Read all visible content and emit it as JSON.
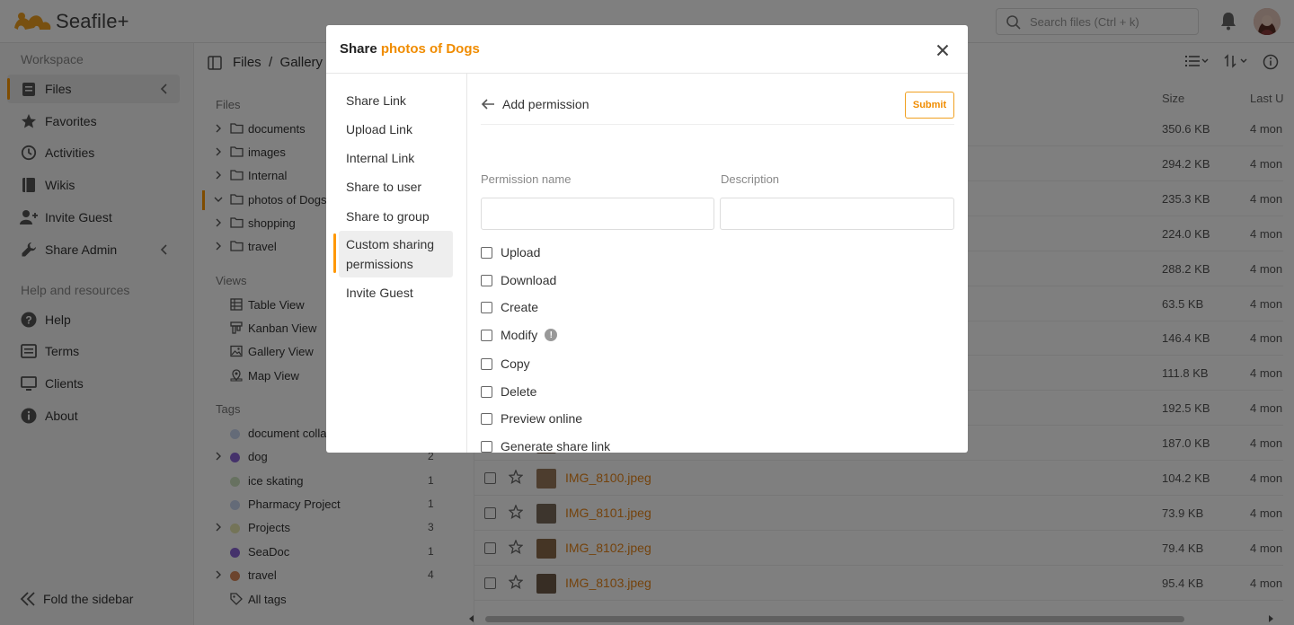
{
  "app": {
    "name": "Seafile+"
  },
  "header": {
    "search_placeholder": "Search files (Ctrl + k)"
  },
  "sidebar": {
    "workspace_title": "Workspace",
    "items": [
      {
        "label": "Files",
        "icon": "files-icon"
      },
      {
        "label": "Favorites",
        "icon": "star-icon"
      },
      {
        "label": "Activities",
        "icon": "clock-icon"
      },
      {
        "label": "Wikis",
        "icon": "book-icon"
      },
      {
        "label": "Invite Guest",
        "icon": "add-user-icon"
      },
      {
        "label": "Share Admin",
        "icon": "wrench-icon"
      }
    ],
    "help_title": "Help and resources",
    "help_items": [
      {
        "label": "Help",
        "icon": "help-icon"
      },
      {
        "label": "Terms",
        "icon": "list-icon"
      },
      {
        "label": "Clients",
        "icon": "monitor-icon"
      },
      {
        "label": "About",
        "icon": "info-icon"
      }
    ],
    "fold_label": "Fold the sidebar"
  },
  "tree": {
    "breadcrumb_root": "Files",
    "breadcrumb_sep": "/",
    "breadcrumb_current": "Gallery v",
    "files_title": "Files",
    "folders": [
      "documents",
      "images",
      "Internal",
      "photos of Dogs",
      "shopping",
      "travel"
    ],
    "views_title": "Views",
    "views": [
      "Table View",
      "Kanban View",
      "Gallery View",
      "Map View"
    ],
    "tags_title": "Tags",
    "tags": [
      {
        "label": "document colla",
        "count": "",
        "color": "#c9d6f0"
      },
      {
        "label": "dog",
        "count": "2",
        "color": "#8a64d6"
      },
      {
        "label": "ice skating",
        "count": "1",
        "color": "#cfe3c0"
      },
      {
        "label": "Pharmacy Project",
        "count": "1",
        "color": "#c9d6f0"
      },
      {
        "label": "Projects",
        "count": "3",
        "color": "#e8e8b0"
      },
      {
        "label": "SeaDoc",
        "count": "1",
        "color": "#8a64d6"
      },
      {
        "label": "travel",
        "count": "4",
        "color": "#d9895a"
      }
    ],
    "all_tags": "All tags"
  },
  "table": {
    "col_size": "Size",
    "col_modified": "Last U",
    "rows": [
      {
        "name": "",
        "size": "350.6 KB",
        "modified": "4 mon"
      },
      {
        "name": "",
        "size": "294.2 KB",
        "modified": "4 mon"
      },
      {
        "name": "",
        "size": "235.3 KB",
        "modified": "4 mon"
      },
      {
        "name": "",
        "size": "224.0 KB",
        "modified": "4 mon"
      },
      {
        "name": "",
        "size": "288.2 KB",
        "modified": "4 mon"
      },
      {
        "name": "",
        "size": "63.5 KB",
        "modified": "4 mon"
      },
      {
        "name": "",
        "size": "146.4 KB",
        "modified": "4 mon"
      },
      {
        "name": "",
        "size": "111.8 KB",
        "modified": "4 mon"
      },
      {
        "name": "",
        "size": "192.5 KB",
        "modified": "4 mon"
      },
      {
        "name": "",
        "size": "187.0 KB",
        "modified": "4 mon"
      },
      {
        "name": "IMG_8100.jpeg",
        "size": "104.2 KB",
        "modified": "4 mon"
      },
      {
        "name": "IMG_8101.jpeg",
        "size": "73.9 KB",
        "modified": "4 mon"
      },
      {
        "name": "IMG_8102.jpeg",
        "size": "79.4 KB",
        "modified": "4 mon"
      },
      {
        "name": "IMG_8103.jpeg",
        "size": "95.4 KB",
        "modified": "4 mon"
      }
    ]
  },
  "modal": {
    "title_prefix": "Share ",
    "title_name": "photos of Dogs",
    "nav": [
      "Share Link",
      "Upload Link",
      "Internal Link",
      "Share to user",
      "Share to group",
      "Custom sharing permissions",
      "Invite Guest"
    ],
    "back_label": "Add permission",
    "submit_label": "Submit",
    "permission_name_label": "Permission name",
    "description_label": "Description",
    "permission_name_value": "",
    "description_value": "",
    "checkboxes": [
      "Upload",
      "Download",
      "Create",
      "Modify",
      "Copy",
      "Delete",
      "Preview online",
      "Generate share link"
    ]
  },
  "colors": {
    "accent": "#ff9800",
    "link": "#e8861a"
  }
}
